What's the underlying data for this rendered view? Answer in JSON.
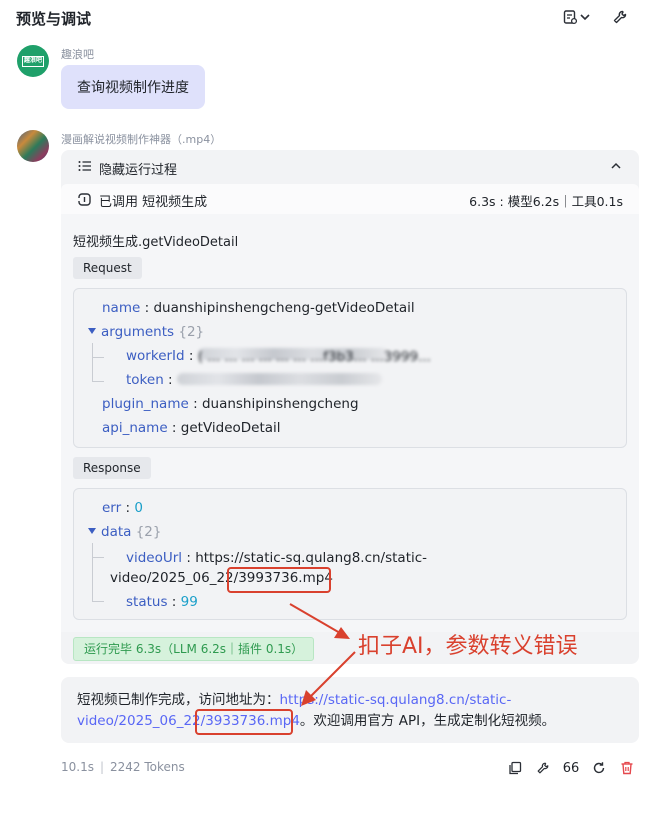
{
  "header": {
    "title": "预览与调试",
    "icons": [
      "doc-settings-icon",
      "chevron-down-icon",
      "wrench-icon"
    ]
  },
  "user_message": {
    "sender": "趣浪吧",
    "avatar_text": "趣浪吧",
    "text": "查询视频制作进度"
  },
  "bot_message": {
    "sender": "漫画解说视频制作神器（.mp4）",
    "run_process": {
      "toggle_label": "隐藏运行过程",
      "tool_call_label": "已调用 短视频生成",
      "timing": "6.3s : 模型6.2s｜工具0.1s",
      "function_name": "短视频生成.getVideoDetail",
      "request_label": "Request",
      "request": {
        "name_key": "name",
        "name_value": "duanshipinshengcheng-getVideoDetail",
        "arguments_key": "arguments",
        "arguments_count": "{2}",
        "worker_id_key": "workerId",
        "worker_id_value": "( ... ... ... ... ... ... ...f3b3... ...3999...",
        "token_key": "token",
        "token_value": "",
        "plugin_name_key": "plugin_name",
        "plugin_name_value": "duanshipinshengcheng",
        "api_name_key": "api_name",
        "api_name_value": "getVideoDetail"
      },
      "response_label": "Response",
      "response": {
        "err_key": "err",
        "err_value": "0",
        "data_key": "data",
        "data_count": "{2}",
        "video_url_key": "videoUrl",
        "video_url_line1": "https://static-sq.qulang8.cn/static-",
        "video_url_line2_prefix": "video/2025_06_22/",
        "video_url_line2_file": "3993736.mp4",
        "status_key": "status",
        "status_value": "99"
      },
      "done_badge": "运行完毕 6.3s（LLM 6.2s｜插件 0.1s）"
    },
    "answer": {
      "prefix": "短视频已制作完成，访问地址为：",
      "link_line1": "https://static-sq.qulang8.cn/static-",
      "link_line2_prefix": "video/2025_06_22/",
      "link_file": "3933736.mp4",
      "suffix": "。欢迎调用官方 API，生成定制化短视频。"
    },
    "footer": {
      "duration": "10.1s",
      "tokens": "2242 Tokens",
      "quote_count": "66"
    }
  },
  "annotation": {
    "text": "扣子AI，参数转义错误",
    "color": "#d9412e"
  },
  "colors": {
    "key_blue": "#3c5ec2",
    "link_purple": "#5967f5",
    "number_cyan": "#1a9fc9",
    "success_green": "#2e9a4f",
    "delete_red": "#e5484d",
    "user_bubble": "#dfe1fb"
  }
}
